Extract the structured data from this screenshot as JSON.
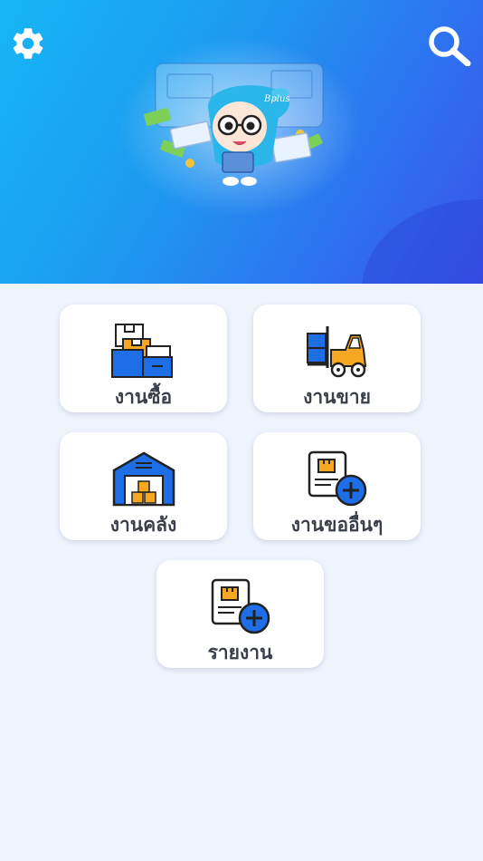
{
  "header": {
    "settings_icon": "gear-icon",
    "search_icon": "search-icon",
    "mascot": "bplus-mascot-illustration",
    "mascot_logo_text": "Bplus"
  },
  "menu": {
    "purchase": {
      "label": "งานซื้อ",
      "icon": "boxes-icon"
    },
    "sales": {
      "label": "งานขาย",
      "icon": "forklift-icon"
    },
    "warehouse": {
      "label": "งานคลัง",
      "icon": "warehouse-icon"
    },
    "requests": {
      "label": "งานขออื่นๆ",
      "icon": "document-add-icon"
    },
    "reports": {
      "label": "รายงาน",
      "icon": "document-add-icon"
    }
  },
  "colors": {
    "header_start": "#16b6f5",
    "header_end": "#3a52ea",
    "background": "#eff3fc",
    "icon_blue": "#1e6ee8",
    "icon_orange": "#f7a823",
    "label": "#3a3f4a"
  }
}
